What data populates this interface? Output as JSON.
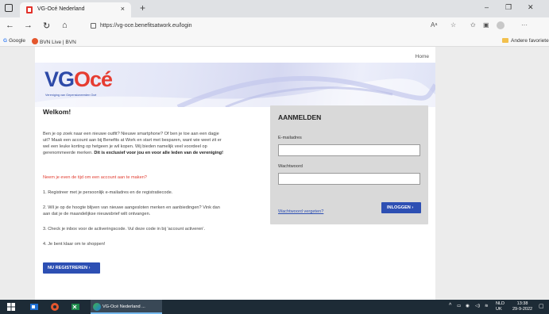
{
  "browser": {
    "tab_title": "VG-Océ Nederland",
    "tab_close": "×",
    "new_tab": "+",
    "url": "https://vg-oce.benefitsatwork.eu/login",
    "nav_back": "←",
    "nav_forward": "→",
    "nav_refresh": "↻",
    "nav_home": "⌂",
    "window_minimize": "–",
    "window_restore": "❐",
    "window_close": "✕",
    "more_menu": "···",
    "bookmarks": [
      {
        "label": "Google"
      },
      {
        "label": "BVN Live | BVN"
      }
    ],
    "other_favorites": "Andere favoriete"
  },
  "page": {
    "home_link": "Home",
    "logo": {
      "vg": "VG",
      "oce": "Océ",
      "subtitle": "Vereniging van Gepensioneerden Océ"
    },
    "welcome_title": "Welkom!",
    "intro_text": "Ben je op zoek naar een nieuwe outfit? Nieuwe smartphone? Of ben je toe aan een dagje uit? Maak een account aan bij Benefits at Work en start met besparen, want wie weet zit er wel een leuke korting op hetgeen je wil kopen. Wij bieden namelijk veel voordeel op gerenommeerde merken.",
    "intro_bold": "Dit is exclusief voor jou en voor alle leden van de vereniging!",
    "new_here_question": "Neem je even de tijd om een account aan te maken?",
    "steps": [
      "1. Registreer met je persoonlijk e-mailadres en de registratiecode.",
      "2. Wil je op de hoogte blijven van nieuwe aangesloten merken en aanbiedingen? Vink dan aan dat je de maandelijkse nieuwsbrief wilt ontvangen.",
      "3. Check je inbox voor de activeringscode. Vul deze code in bij 'account activeren'.",
      "4. Je bent klaar om te shoppen!"
    ],
    "register_button": "NU REGISTREREN  ›",
    "login": {
      "title": "AANMELDEN",
      "email_label": "E-mailadres",
      "email_value": "",
      "password_label": "Wachtwoord",
      "password_value": "",
      "forgot_link": "Wachtwoord vergeten?",
      "login_button": "INLOGGEN  ›"
    }
  },
  "taskbar": {
    "active_window": "VG-Océ Nederland ...",
    "language": "NLD",
    "region": "UK",
    "time": "13:38",
    "date": "29-9-2022",
    "tray_expand": "^"
  },
  "colors": {
    "brand_blue": "#2d4fb3",
    "brand_red": "#e63c31",
    "taskbar": "#1d2b36"
  }
}
